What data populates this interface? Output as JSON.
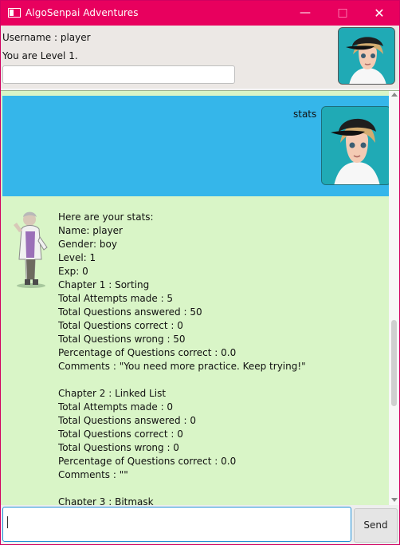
{
  "window": {
    "title": "AlgoSenpai Adventures",
    "minimize": "—",
    "maximize": "□",
    "close": "✕"
  },
  "header": {
    "username": "Username : player",
    "level": "You are Level 1.",
    "progress": 0
  },
  "chat": {
    "user_message": "stats",
    "bot_lines": [
      "Here are your stats:",
      "Name: player",
      "Gender: boy",
      "Level: 1",
      "Exp: 0",
      "Chapter 1 : Sorting",
      "Total Attempts made : 5",
      "Total Questions answered : 50",
      "Total Questions correct : 0",
      "Total Questions wrong : 50",
      "Percentage of Questions correct : 0.0",
      "Comments : \"You need more practice. Keep trying!\"",
      "",
      "Chapter 2 : Linked List",
      "Total Attempts made : 0",
      "Total Questions answered : 0",
      "Total Questions correct : 0",
      "Total Questions wrong : 0",
      "Percentage of Questions correct : 0.0",
      "Comments : \"\"",
      "",
      "Chapter 3 : Bitmask"
    ]
  },
  "input": {
    "value": "",
    "placeholder": ""
  },
  "send": {
    "label": "Send"
  },
  "colors": {
    "titlebar": "#e8005e",
    "user_bubble": "#35b6ea",
    "chat_bg": "#d9f5c7",
    "header_bg": "#ece8e5"
  },
  "icons": [
    "app-window-icon",
    "minimize-icon",
    "maximize-icon",
    "close-icon",
    "player-avatar-icon",
    "professor-avatar-icon",
    "scroll-up-icon",
    "scroll-down-icon"
  ]
}
